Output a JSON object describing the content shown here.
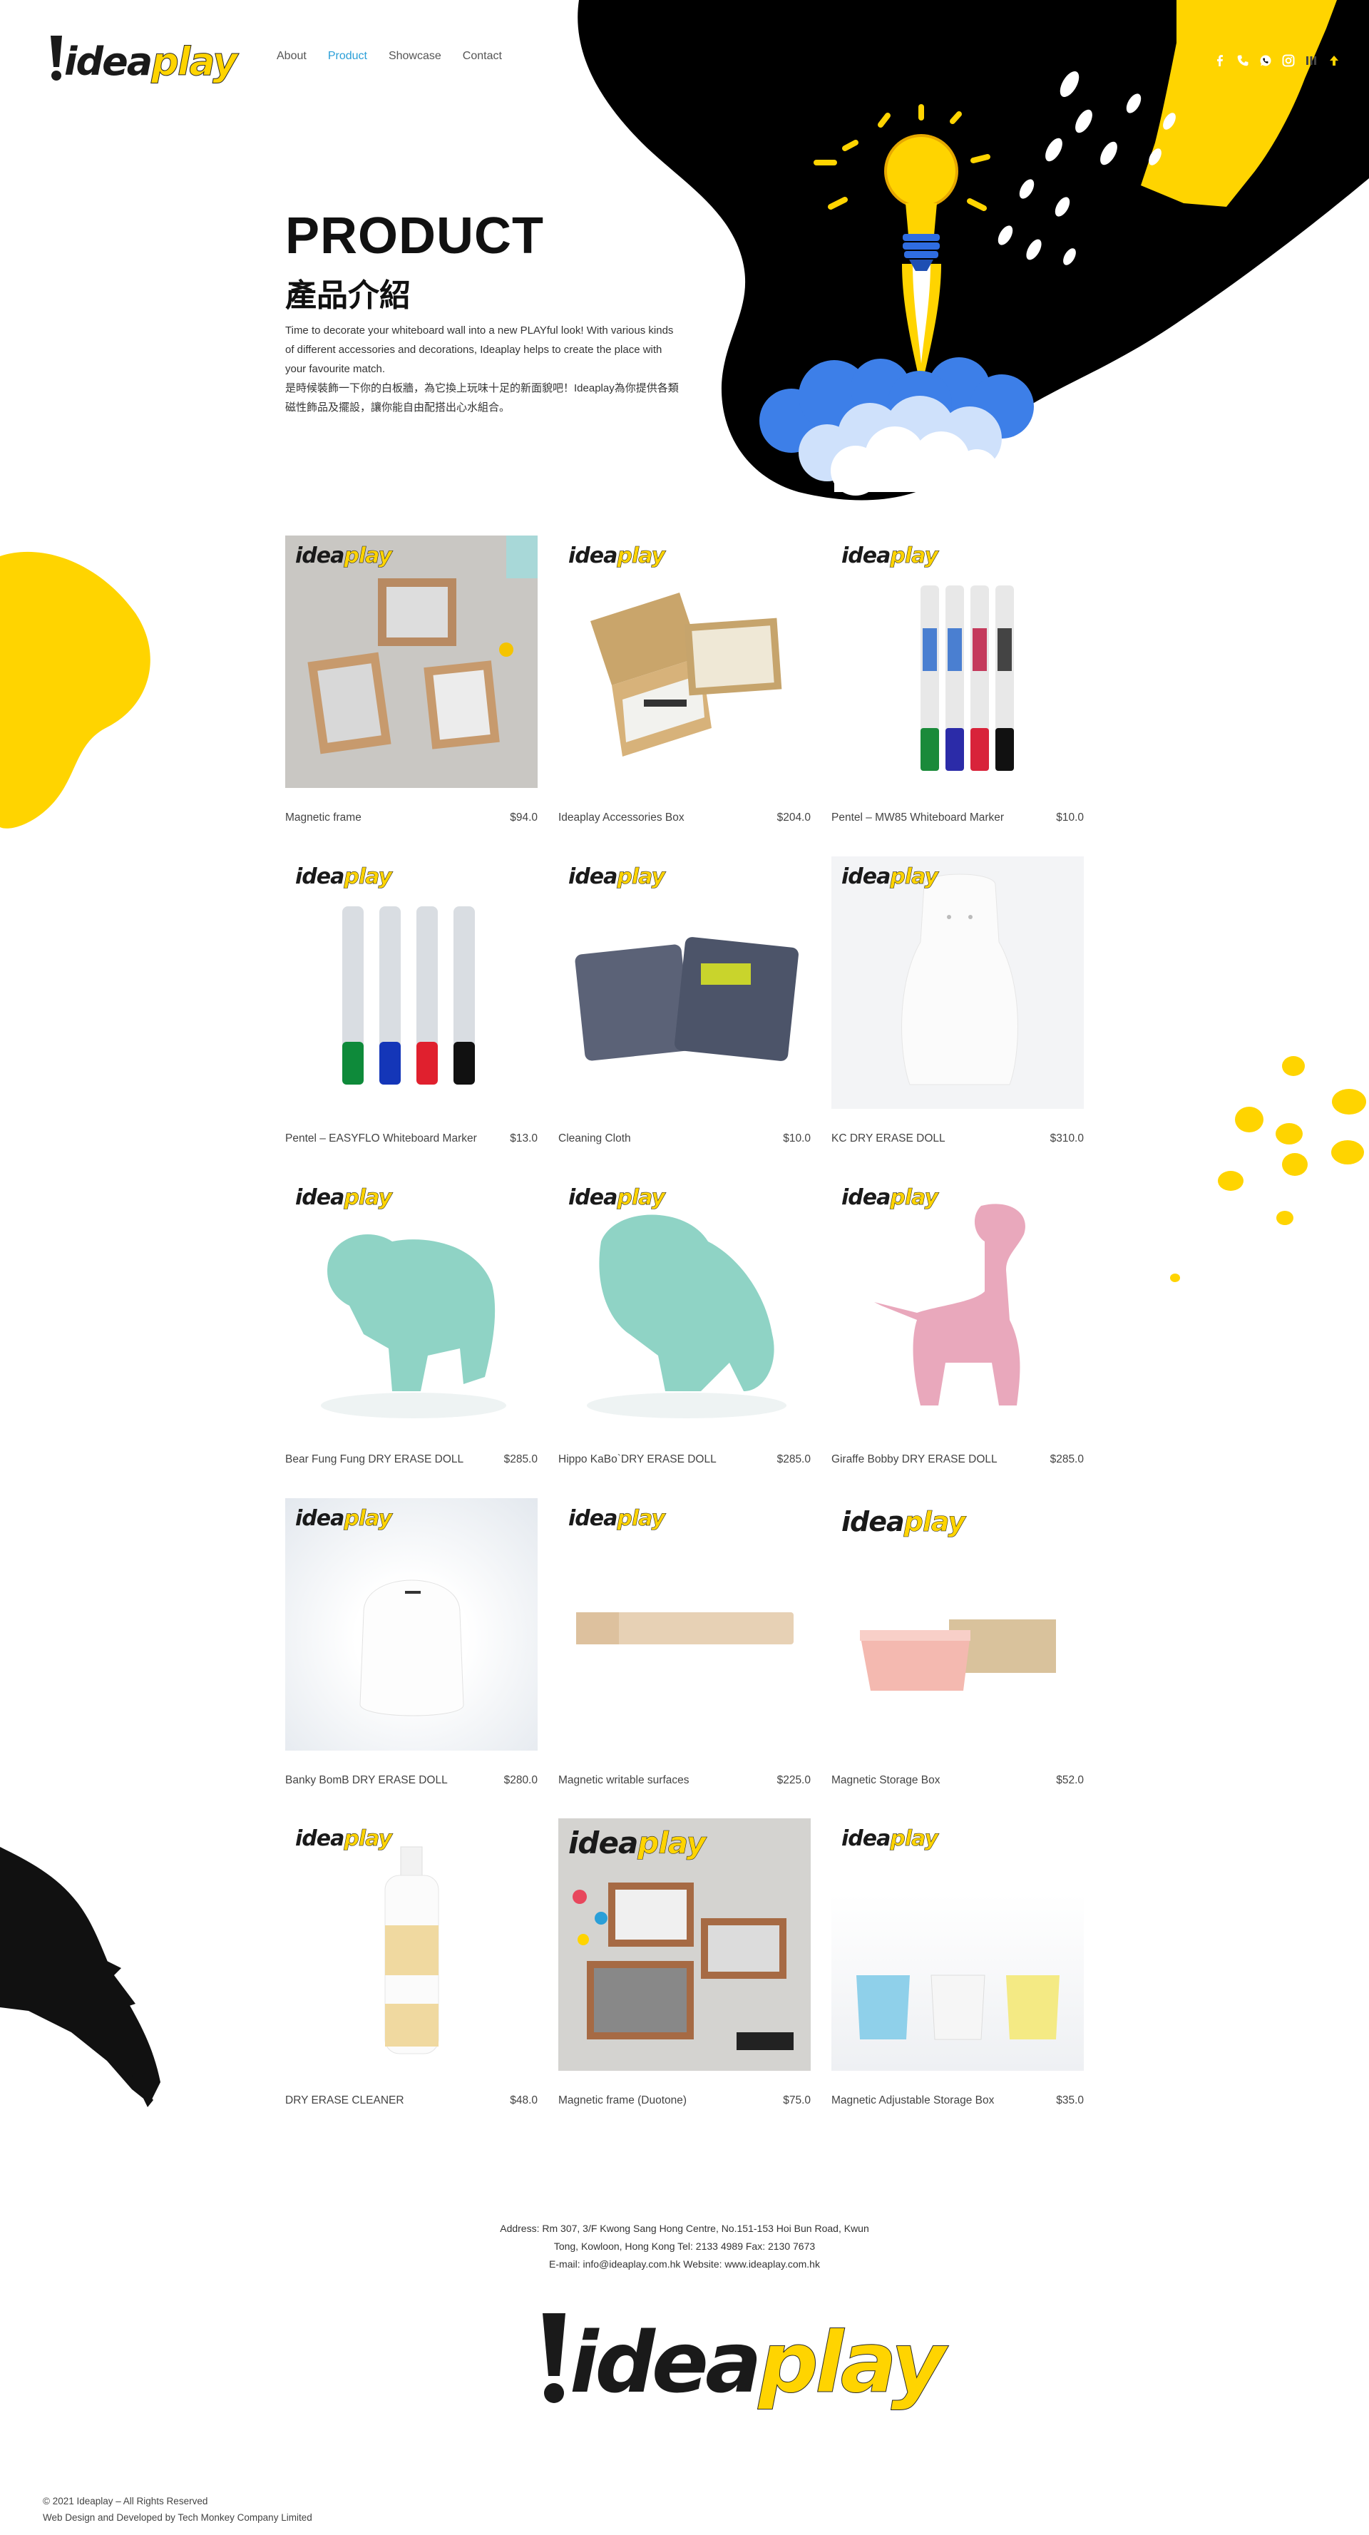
{
  "brand": {
    "dark": "idea",
    "yellow": "play",
    "accent": "#ffd400"
  },
  "nav": {
    "items": [
      {
        "label": "About",
        "active": false
      },
      {
        "label": "Product",
        "active": true
      },
      {
        "label": "Showcase",
        "active": false
      },
      {
        "label": "Contact",
        "active": false
      }
    ]
  },
  "social": [
    "facebook-icon",
    "phone-icon",
    "whatsapp-icon",
    "instagram-icon",
    "menu-icon",
    "arrow-up-icon"
  ],
  "hero": {
    "title": "PRODUCT",
    "subtitle": "產品介紹",
    "desc_en": "Time to decorate your whiteboard wall into a new PLAYful look! With various kinds of different accessories and decorations, Ideaplay helps to create the place with your favourite match.",
    "desc_zh": "是時候裝飾一下你的白板牆，為它換上玩味十足的新面貌吧！Ideaplay為你提供各類磁性飾品及擺設，讓你能自由配搭出心水組合。"
  },
  "products": [
    {
      "name": "Magnetic frame",
      "price": "$94.0"
    },
    {
      "name": "Ideaplay Accessories Box",
      "price": "$204.0"
    },
    {
      "name": "Pentel – MW85 Whiteboard Marker",
      "price": "$10.0"
    },
    {
      "name": "Pentel – EASYFLO Whiteboard Marker",
      "price": "$13.0"
    },
    {
      "name": "Cleaning Cloth",
      "price": "$10.0"
    },
    {
      "name": "KC DRY ERASE DOLL",
      "price": "$310.0"
    },
    {
      "name": "Bear Fung Fung DRY ERASE DOLL",
      "price": "$285.0"
    },
    {
      "name": "Hippo KaBo`DRY ERASE DOLL",
      "price": "$285.0"
    },
    {
      "name": "Giraffe Bobby DRY ERASE DOLL",
      "price": "$285.0"
    },
    {
      "name": "Banky BomB DRY ERASE DOLL",
      "price": "$280.0"
    },
    {
      "name": "Magnetic writable surfaces",
      "price": "$225.0"
    },
    {
      "name": "Magnetic Storage Box",
      "price": "$52.0"
    },
    {
      "name": "DRY ERASE CLEANER",
      "price": "$48.0"
    },
    {
      "name": "Magnetic frame (Duotone)",
      "price": "$75.0"
    },
    {
      "name": "Magnetic Adjustable Storage Box",
      "price": "$35.0"
    }
  ],
  "footer": {
    "address_line1": "Address: Rm 307, 3/F Kwong Sang Hong Centre, No.151-153 Hoi Bun Road, Kwun",
    "address_line2": "Tong, Kowloon, Hong Kong Tel: 2133 4989 Fax: 2130 7673",
    "address_line3": "E-mail: info@ideaplay.com.hk Website: www.ideaplay.com.hk",
    "copyright": "© 2021 Ideaplay – All Rights Reserved",
    "credit": "Web Design and Developed by Tech Monkey Company Limited"
  }
}
